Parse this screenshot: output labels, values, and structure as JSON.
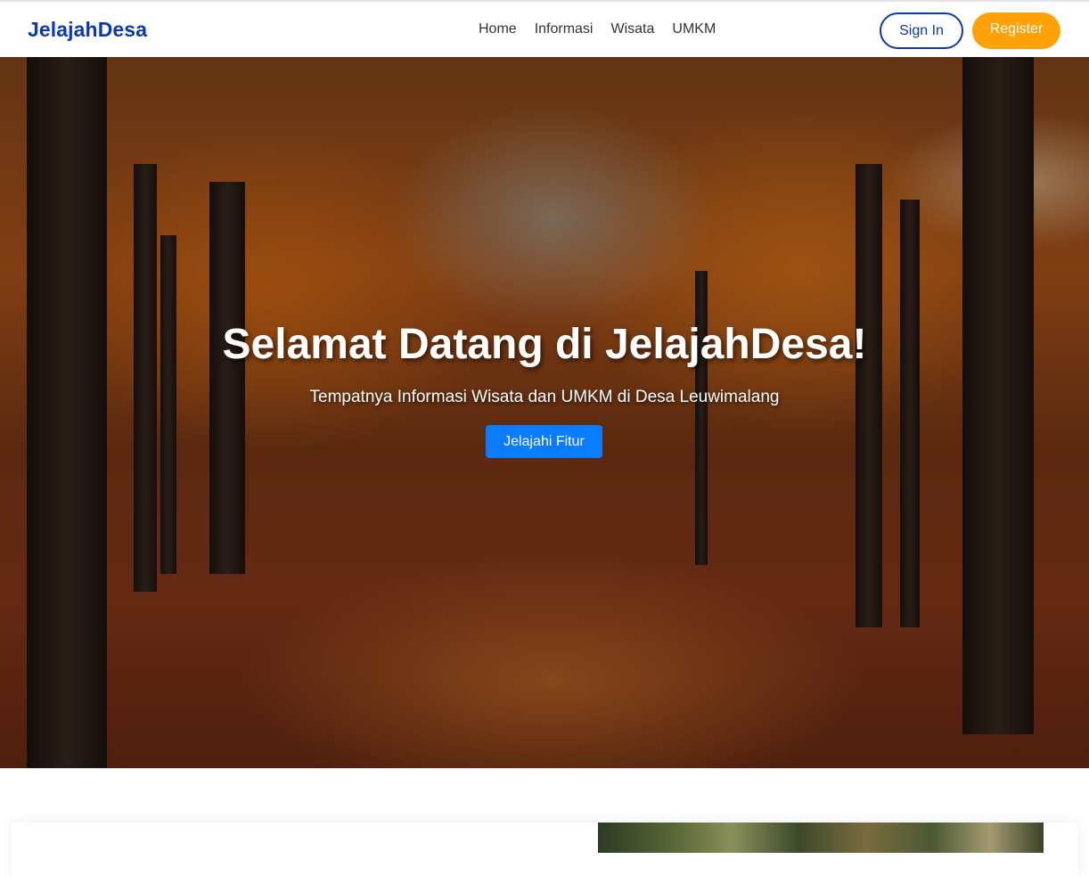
{
  "navbar": {
    "brand": "JelajahDesa",
    "links": [
      "Home",
      "Informasi",
      "Wisata",
      "UMKM"
    ],
    "signin_label": "Sign In",
    "register_label": "Register"
  },
  "hero": {
    "title": "Selamat Datang di JelajahDesa!",
    "subtitle": "Tempatnya Informasi Wisata dan UMKM di Desa Leuwimalang",
    "button_label": "Jelajahi Fitur"
  },
  "colors": {
    "brand": "#0a39b8",
    "register": "#ffa20a",
    "primary_button": "#0b7bff"
  }
}
